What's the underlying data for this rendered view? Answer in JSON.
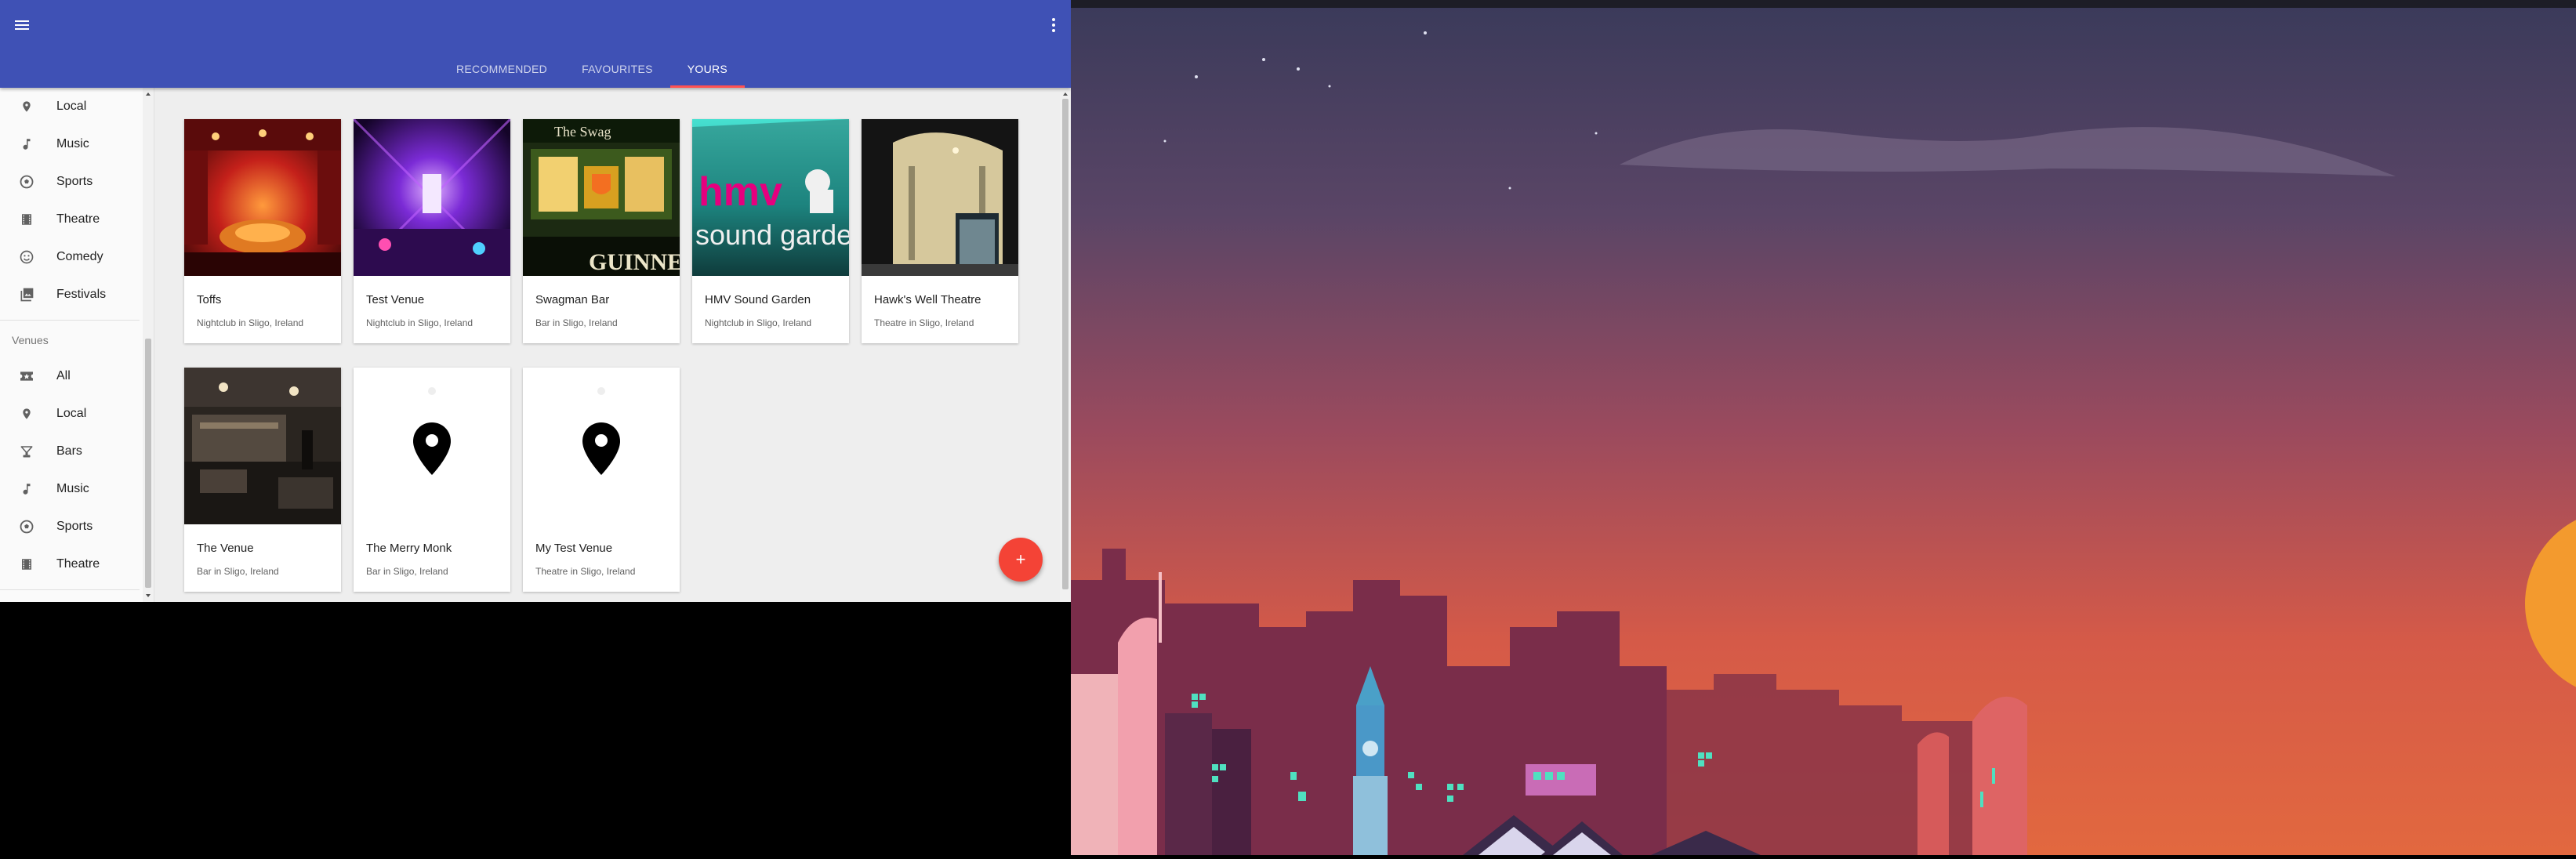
{
  "colors": {
    "primary": "#3f51b5",
    "tab_indicator": "#ff5252",
    "fab": "#f44336"
  },
  "appbar": {
    "menu_icon": "hamburger-menu-icon",
    "more_icon": "more-vert-icon",
    "tabs": [
      {
        "label": "RECOMMENDED",
        "active": false
      },
      {
        "label": "FAVOURITES",
        "active": false
      },
      {
        "label": "YOURS",
        "active": true
      }
    ]
  },
  "sidebar": {
    "events_items": [
      {
        "label": "Local",
        "icon": "location-pin-icon"
      },
      {
        "label": "Music",
        "icon": "music-note-icon"
      },
      {
        "label": "Sports",
        "icon": "soccer-ball-icon"
      },
      {
        "label": "Theatre",
        "icon": "theatre-film-icon"
      },
      {
        "label": "Comedy",
        "icon": "smiley-face-icon"
      },
      {
        "label": "Festivals",
        "icon": "photo-library-icon"
      }
    ],
    "venues_header": "Venues",
    "venues_items": [
      {
        "label": "All",
        "icon": "ticket-icon"
      },
      {
        "label": "Local",
        "icon": "location-pin-icon"
      },
      {
        "label": "Bars",
        "icon": "cocktail-glass-icon"
      },
      {
        "label": "Music",
        "icon": "music-note-icon"
      },
      {
        "label": "Sports",
        "icon": "soccer-ball-icon"
      },
      {
        "label": "Theatre",
        "icon": "theatre-film-icon"
      }
    ]
  },
  "venues": [
    {
      "name": "Toffs",
      "subtitle": "Nightclub in Sligo, Ireland",
      "image": "photo"
    },
    {
      "name": "Test Venue",
      "subtitle": "Nightclub in Sligo, Ireland",
      "image": "photo"
    },
    {
      "name": "Swagman Bar",
      "subtitle": "Bar in Sligo, Ireland",
      "image": "photo"
    },
    {
      "name": "HMV Sound Garden",
      "subtitle": "Nightclub in Sligo, Ireland",
      "image": "photo"
    },
    {
      "name": "Hawk's Well Theatre",
      "subtitle": "Theatre in Sligo, Ireland",
      "image": "photo"
    },
    {
      "name": "The Venue",
      "subtitle": "Bar in Sligo, Ireland",
      "image": "photo"
    },
    {
      "name": "The Merry Monk",
      "subtitle": "Bar in Sligo, Ireland",
      "image": "placeholder"
    },
    {
      "name": "My Test Venue",
      "subtitle": "Theatre in Sligo, Ireland",
      "image": "placeholder"
    }
  ],
  "fab": {
    "label": "+",
    "icon": "add-icon"
  },
  "hmv_logo": {
    "line1": "hmv",
    "line2": "sound garden"
  },
  "swagman_sign": {
    "top": "The Swag",
    "bottom": "GUINNES"
  }
}
